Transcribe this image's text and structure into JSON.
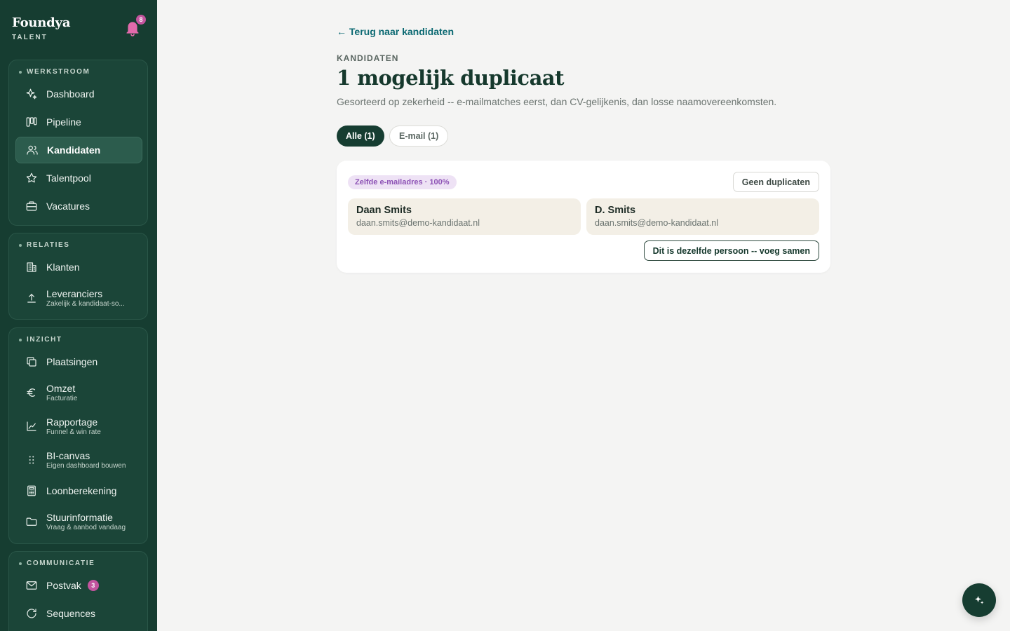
{
  "brand": {
    "name": "Foundya",
    "sub": "TALENT",
    "notifications": "8"
  },
  "sidebar": {
    "werkstroom": {
      "title": "WERKSTROOM",
      "items": [
        {
          "label": "Dashboard",
          "icon": "sparkle-icon"
        },
        {
          "label": "Pipeline",
          "icon": "kanban-icon"
        },
        {
          "label": "Kandidaten",
          "icon": "users-icon",
          "active": true
        },
        {
          "label": "Talentpool",
          "icon": "star-icon"
        },
        {
          "label": "Vacatures",
          "icon": "briefcase-icon"
        }
      ]
    },
    "relaties": {
      "title": "RELATIES",
      "items": [
        {
          "label": "Klanten",
          "icon": "building-icon"
        },
        {
          "label": "Leveranciers",
          "sub": "Zakelijk & kandidaat-so...",
          "icon": "upload-icon"
        }
      ]
    },
    "inzicht": {
      "title": "INZICHT",
      "items": [
        {
          "label": "Plaatsingen",
          "icon": "copy-icon"
        },
        {
          "label": "Omzet",
          "sub": "Facturatie",
          "icon": "euro-icon"
        },
        {
          "label": "Rapportage",
          "sub": "Funnel & win rate",
          "icon": "chart-icon"
        },
        {
          "label": "BI-canvas",
          "sub": "Eigen dashboard bouwen",
          "icon": "grip-icon"
        },
        {
          "label": "Loonberekening",
          "icon": "calculator-icon"
        },
        {
          "label": "Stuurinformatie",
          "sub": "Vraag & aanbod vandaag",
          "icon": "folder-icon"
        }
      ]
    },
    "communicatie": {
      "title": "COMMUNICATIE",
      "items": [
        {
          "label": "Postvak",
          "icon": "mail-icon",
          "count": "3"
        },
        {
          "label": "Sequences",
          "icon": "refresh-icon"
        }
      ]
    }
  },
  "main": {
    "back": "← Terug naar kandidaten",
    "eyebrow": "KANDIDATEN",
    "title": "1 mogelijk duplicaat",
    "subtitle": "Gesorteerd op zekerheid -- e-mailmatches eerst, dan CV-gelijkenis, dan losse naamovereenkomsten.",
    "filters": [
      {
        "label": "Alle (1)",
        "selected": true
      },
      {
        "label": "E-mail (1)",
        "selected": false
      }
    ],
    "duplicate": {
      "badge": "Zelfde e-mailadres · 100%",
      "dismiss": "Geen duplicaten",
      "merge": "Dit is dezelfde persoon -- voeg samen",
      "a": {
        "name": "Daan Smits",
        "email": "daan.smits@demo-kandidaat.nl"
      },
      "b": {
        "name": "D. Smits",
        "email": "daan.smits@demo-kandidaat.nl"
      }
    }
  },
  "colors": {
    "sidebar": "#163d31",
    "accent": "#0d6a73",
    "badge": "#c3549e",
    "match": "#8d52b5"
  }
}
